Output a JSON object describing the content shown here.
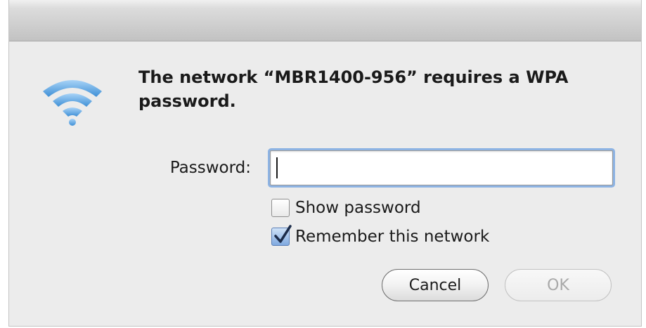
{
  "dialog": {
    "message": "The network “MBR1400-956” requires a WPA password.",
    "password_label": "Password:",
    "password_value": "",
    "show_password": {
      "label": "Show password",
      "checked": false
    },
    "remember_network": {
      "label": "Remember this network",
      "checked": true
    },
    "cancel_label": "Cancel",
    "ok_label": "OK",
    "icon": "wifi-icon"
  },
  "colors": {
    "wifi_blue": "#5ea8e6",
    "focus_ring": "#8db3e3",
    "check_blue": "#7fa9e0"
  }
}
